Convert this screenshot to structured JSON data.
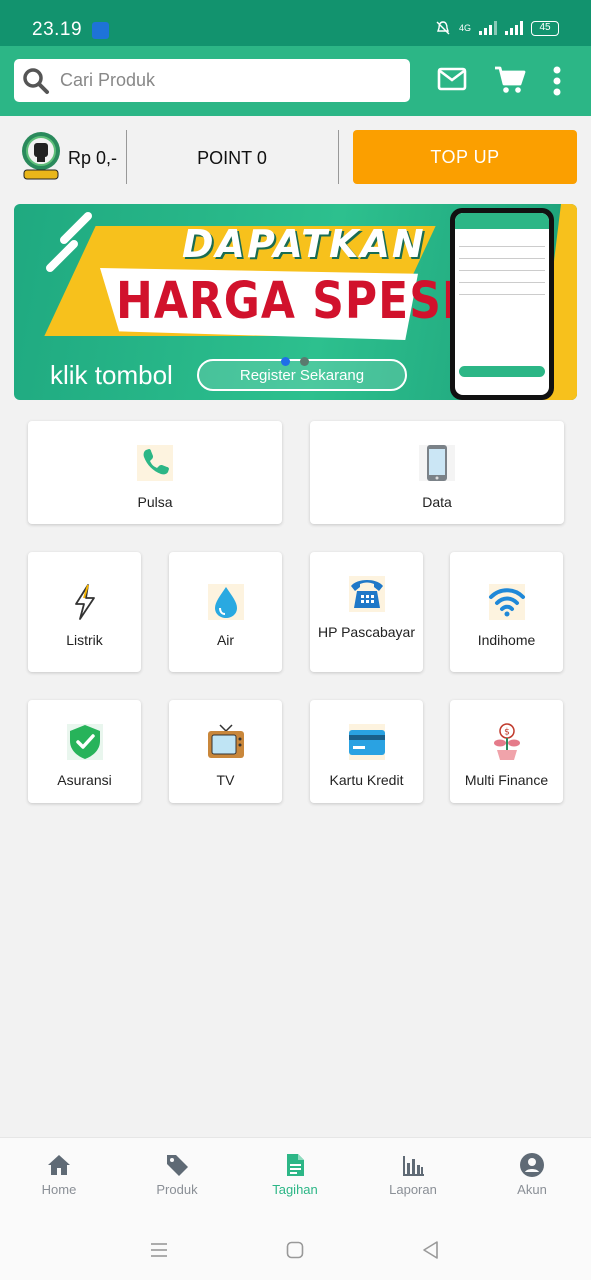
{
  "status_bar": {
    "time": "23.19",
    "network": "4G",
    "battery": "45"
  },
  "header": {
    "search_placeholder": "Cari Produk",
    "icons": [
      "mail-icon",
      "cart-icon",
      "more-vert-icon"
    ]
  },
  "account": {
    "balance": "Rp 0,-",
    "points": "POINT 0",
    "topup_label": "TOP UP"
  },
  "banner": {
    "headline_1": "DAPATKAN",
    "headline_2": "HARGA SPESIAL",
    "caption": "klik tombol",
    "button_label": "Register Sekarang",
    "slide_count": 2,
    "active_slide": 1
  },
  "services": [
    {
      "label": "Pulsa",
      "icon": "phone-icon"
    },
    {
      "label": "Data",
      "icon": "smartphone-icon"
    },
    {
      "label": "Listrik",
      "icon": "lightning-icon"
    },
    {
      "label": "Air",
      "icon": "water-drop-icon"
    },
    {
      "label": "HP Pascabayar",
      "icon": "telephone-icon"
    },
    {
      "label": "Indihome",
      "icon": "wifi-icon"
    },
    {
      "label": "Asuransi",
      "icon": "shield-check-icon"
    },
    {
      "label": "TV",
      "icon": "tv-icon"
    },
    {
      "label": "Kartu Kredit",
      "icon": "credit-card-icon"
    },
    {
      "label": "Multi Finance",
      "icon": "money-plant-icon"
    }
  ],
  "bottom_nav": [
    {
      "label": "Home",
      "icon": "home-icon"
    },
    {
      "label": "Produk",
      "icon": "tag-icon"
    },
    {
      "label": "Tagihan",
      "icon": "document-icon",
      "active": true
    },
    {
      "label": "Laporan",
      "icon": "bar-chart-icon"
    },
    {
      "label": "Akun",
      "icon": "account-icon"
    }
  ],
  "colors": {
    "status_bar": "#12936e",
    "primary": "#2cb686",
    "accent": "#fb9f00",
    "banner_red": "#d1122c",
    "banner_yellow": "#f7c11c"
  }
}
